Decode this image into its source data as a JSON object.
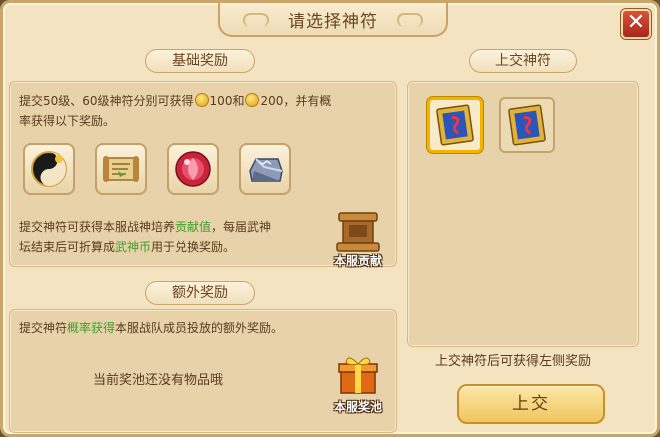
{
  "window": {
    "title": "请选择神符"
  },
  "close": {
    "label": "✕"
  },
  "basic": {
    "tab": "基础奖励",
    "desc_part1": "提交50级、60级神符分别可获得",
    "coin1_amount": "100和",
    "coin2_amount": "200，并有概",
    "desc_part2": "率获得以下奖励。",
    "items": [
      {
        "icon": "yin-yang-orb-icon"
      },
      {
        "icon": "scroll-icon"
      },
      {
        "icon": "red-orb-icon"
      },
      {
        "icon": "silver-ingot-icon"
      }
    ],
    "contrib_line1_a": "提交神符可获得本服战神培养",
    "contrib_line1_hl": "贡献值",
    "contrib_line1_b": "，每届武神",
    "contrib_line2_a": "坛结束后可折算成",
    "contrib_line2_hl": "武神币",
    "contrib_line2_b": "用于兑换奖励。",
    "badge_label": "本服贡献"
  },
  "extra": {
    "tab": "额外奖励",
    "desc_a": "提交神符",
    "desc_hl": "概率获得",
    "desc_b": "本服战队成员投放的额外奖励。",
    "empty_text": "当前奖池还没有物品哦",
    "badge_label": "本服奖池"
  },
  "submit_panel": {
    "tab": "上交神符",
    "runes": [
      {
        "icon": "rune-card-icon",
        "selected": true
      },
      {
        "icon": "rune-card-icon",
        "selected": false
      }
    ],
    "hint": "上交神符后可获得左侧奖励",
    "button": "上交"
  },
  "colors": {
    "highlight": "#3fa02a",
    "selected_border": "#f3b400",
    "close_button": "#c0392b"
  }
}
